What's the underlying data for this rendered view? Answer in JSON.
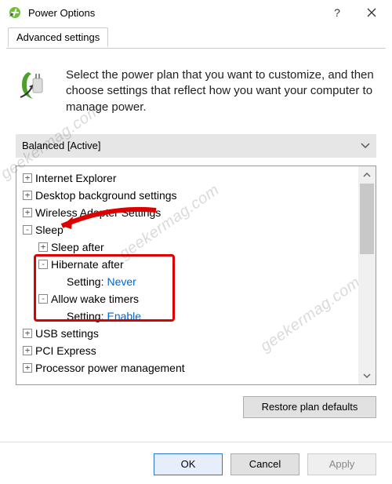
{
  "window": {
    "title": "Power Options"
  },
  "tabs": {
    "advanced": "Advanced settings"
  },
  "intro": {
    "text": "Select the power plan that you want to customize, and then choose settings that reflect how you want your computer to manage power."
  },
  "plan_selector": {
    "selected": "Balanced [Active]"
  },
  "tree": {
    "ie": "Internet Explorer",
    "desktop": "Desktop background settings",
    "wireless": "Wireless Adapter Settings",
    "sleep": "Sleep",
    "sleep_after": "Sleep after",
    "hibernate_after": "Hibernate after",
    "hibernate_setting_label": "Setting:",
    "hibernate_setting_value": "Never",
    "wake_timers": "Allow wake timers",
    "wake_setting_label": "Setting:",
    "wake_setting_value": "Enable",
    "usb": "USB settings",
    "pci": "PCI Express",
    "processor": "Processor power management"
  },
  "buttons": {
    "restore": "Restore plan defaults",
    "ok": "OK",
    "cancel": "Cancel",
    "apply": "Apply"
  },
  "watermark": "geekermag.com"
}
